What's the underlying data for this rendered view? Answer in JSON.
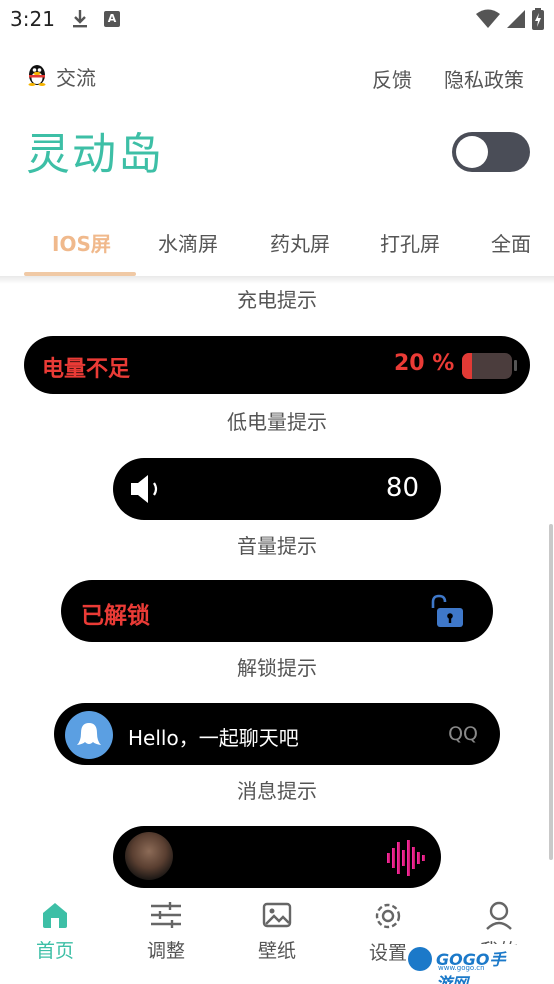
{
  "status_bar": {
    "time": "3:21"
  },
  "header": {
    "qq_link": "交流",
    "feedback": "反馈",
    "privacy": "隐私政策",
    "title": "灵动岛",
    "toggle_on": false
  },
  "tabs": [
    "IOS屏",
    "水滴屏",
    "药丸屏",
    "打孔屏",
    "全面"
  ],
  "active_tab": 0,
  "sections": {
    "charging_caption": "充电提示",
    "battery": {
      "label": "电量不足",
      "percent_text": "20 %",
      "level": 0.2
    },
    "low_battery_caption": "低电量提示",
    "volume": {
      "value": "80"
    },
    "volume_caption": "音量提示",
    "unlock": {
      "label": "已解锁"
    },
    "unlock_caption": "解锁提示",
    "message": {
      "text": "Hello，一起聊天吧",
      "app": "QQ"
    },
    "message_caption": "消息提示"
  },
  "nav": [
    {
      "label": "首页",
      "icon": "home-icon"
    },
    {
      "label": "调整",
      "icon": "sliders-icon"
    },
    {
      "label": "壁纸",
      "icon": "image-icon"
    },
    {
      "label": "设置",
      "icon": "gear-icon"
    },
    {
      "label": "我的",
      "icon": "user-icon"
    }
  ],
  "watermark": {
    "brand": "GOGO手游网",
    "url": "www.gogo.cn"
  },
  "colors": {
    "accent": "#3dbfa6",
    "tab_active": "#f0b98c",
    "alert_red": "#ea3b36"
  }
}
